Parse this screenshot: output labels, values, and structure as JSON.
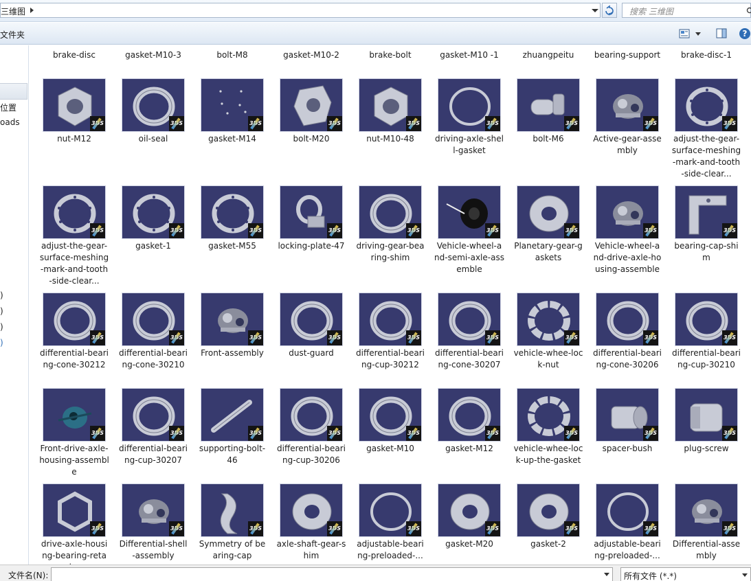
{
  "address": {
    "path": "三维图"
  },
  "search": {
    "placeholder": "搜索 三维图"
  },
  "commands": {
    "new_folder": "文件夹"
  },
  "sidebar": {
    "items": [
      {
        "label": "位置"
      },
      {
        "label": "oads"
      },
      {
        "label": ")"
      },
      {
        "label": ")"
      },
      {
        "label": ")"
      },
      {
        "label": ")"
      }
    ]
  },
  "top_row": [
    "brake-disc",
    "gasket-M10-3",
    "bolt-M8",
    "gasket-M10-2",
    "brake-bolt",
    "gasket-M10 -1",
    "zhuangpeitu",
    "bearing-support",
    "brake-disc-1"
  ],
  "rows": [
    [
      "nut-M12",
      "oil-seal",
      "gasket-M14",
      "bolt-M20",
      "nut-M10-48",
      "driving-axle-shell-gasket",
      "bolt-M6",
      "Active-gear-assembly",
      "adjust-the-gear-surface-meshing-mark-and-tooth-side-clear..."
    ],
    [
      "adjust-the-gear-surface-meshing-mark-and-tooth-side-clear...",
      "gasket-1",
      "gasket-M55",
      "locking-plate-47",
      "driving-gear-bearing-shim",
      "Vehicle-wheel-and-semi-axle-assemble",
      "Planetary-gear-gaskets",
      "Vehicle-wheel-and-drive-axle-housing-assemble",
      "bearing-cap-shim"
    ],
    [
      "differential-bearing-cone-30212",
      "differential-bearing-cone-30210",
      "Front-assembly",
      "dust-guard",
      "differential-bearing-cup-30212",
      "differential-bearing-cone-30207",
      "vehicle-whee-lock-nut",
      "differential-bearing-cone-30206",
      "differential-bearing-cup-30210"
    ],
    [
      "Front-drive-axle-housing-assemble",
      "differential-bearing-cup-30207",
      "supporting-bolt-46",
      "differential-bearing-cup-30206",
      "gasket-M10",
      "gasket-M12",
      "vehicle-whee-lock-up-the-gasket",
      "spacer-bush",
      "plug-screw"
    ],
    [
      "drive-axle-housing-bearing-retai...",
      "Differential-shell-assembly",
      "Symmetry of bearing-cap",
      "axle-shaft-gear-shim",
      "adjustable-bearing-preloaded-...",
      "gasket-M20",
      "gasket-2",
      "adjustable-bearing-preloaded-...",
      "Differential-assembly"
    ]
  ],
  "thumb_shapes": [
    [
      "hexnut",
      "ring",
      "dots",
      "block",
      "hexnut",
      "thinring",
      "bolt",
      "assembly",
      "flange"
    ],
    [
      "flange",
      "flange",
      "flange",
      "lockplate",
      "ring",
      "wheel",
      "washer",
      "assembly",
      "bracket"
    ],
    [
      "ring",
      "ring",
      "assembly",
      "ring",
      "ring",
      "ring",
      "locknut",
      "ring",
      "ring"
    ],
    [
      "housing",
      "ring",
      "shaft",
      "ring",
      "ring",
      "ring",
      "locknut",
      "bush",
      "plug"
    ],
    [
      "hexring",
      "assembly",
      "cap",
      "washer",
      "thinring",
      "washer",
      "washer",
      "thinring",
      "assembly"
    ]
  ],
  "catia_badge": "3DS",
  "bottom": {
    "filename_label": "文件名(N):",
    "filename_value": "",
    "filter_value": "所有文件 (*.*)"
  }
}
